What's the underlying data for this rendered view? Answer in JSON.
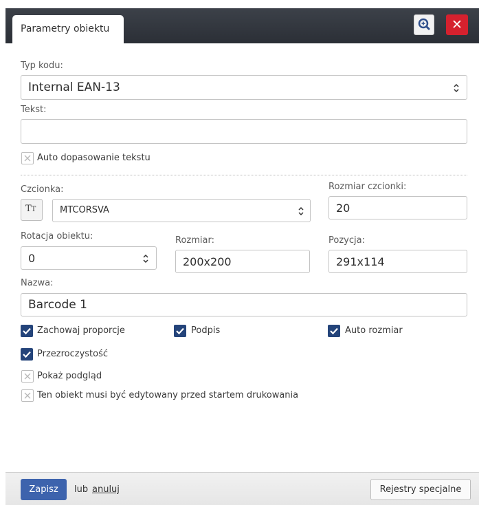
{
  "dialog": {
    "tab_title": "Parametry obiektu",
    "zoom_icon": "zoom-in-icon",
    "close_icon": "close-icon",
    "close_glyph": "✕"
  },
  "form": {
    "code_type": {
      "label": "Typ kodu:",
      "value": "Internal EAN-13"
    },
    "text": {
      "label": "Tekst:",
      "value": ""
    },
    "auto_fit_text": {
      "label": "Auto dopasowanie tekstu",
      "checked": false
    },
    "font": {
      "label": "Czcionka:",
      "tt_button": "TT",
      "value": "MTCORSVA"
    },
    "font_size": {
      "label": "Rozmiar czcionki:",
      "value": "20"
    },
    "rotation": {
      "label": "Rotacja obiektu:",
      "value": "0"
    },
    "size": {
      "label": "Rozmiar:",
      "value": "200x200"
    },
    "position": {
      "label": "Pozycja:",
      "value": "291x114"
    },
    "name": {
      "label": "Nazwa:",
      "value": "Barcode 1"
    },
    "keep_proportions": {
      "label": "Zachowaj proporcje",
      "checked": true
    },
    "caption": {
      "label": "Podpis",
      "checked": true
    },
    "auto_size": {
      "label": "Auto rozmiar",
      "checked": true
    },
    "transparency": {
      "label": "Przezroczystość",
      "checked": true
    },
    "show_preview": {
      "label": "Pokaż podgląd",
      "checked": false
    },
    "edit_before_print": {
      "label": "Ten obiekt musi być edytowany przed startem drukowania",
      "checked": false
    }
  },
  "footer": {
    "save_label": "Zapisz",
    "or_text": "lub",
    "cancel_label": "anuluj",
    "special_registers_label": "Rejestry specjalne"
  },
  "colors": {
    "checkbox_checked": "#24447a",
    "save_button": "#3d63ad",
    "close_button": "#d5212e",
    "titlebar": "#2b2f36"
  }
}
